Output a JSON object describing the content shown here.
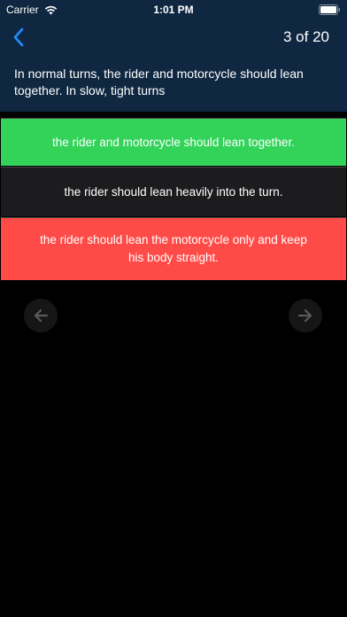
{
  "status_bar": {
    "carrier": "Carrier",
    "time": "1:01 PM"
  },
  "nav": {
    "counter": "3 of 20"
  },
  "question": {
    "text": "In normal turns, the rider and motorcycle should lean together. In slow, tight turns"
  },
  "answers": [
    {
      "text": "the rider and motorcycle should lean together.",
      "state": "correct"
    },
    {
      "text": "the rider should lean heavily into the turn.",
      "state": "neutral"
    },
    {
      "text": "the rider should lean the motorcycle only and keep his body straight.",
      "state": "incorrect"
    }
  ],
  "icons": {
    "back": "chevron-left-icon",
    "prev": "arrow-left-icon",
    "next": "arrow-right-icon",
    "wifi": "wifi-icon",
    "battery": "battery-icon"
  },
  "colors": {
    "header_bg": "#0f2740",
    "accent": "#1e90ff",
    "correct": "#33d35a",
    "incorrect": "#ff4b47",
    "neutral": "#1c1c1e"
  }
}
